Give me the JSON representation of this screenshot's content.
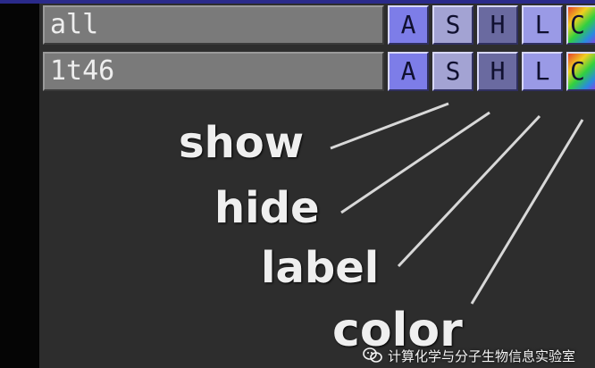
{
  "object_panel": {
    "rows": [
      {
        "name": "all",
        "buttons": {
          "action": "A",
          "show": "S",
          "hide": "H",
          "label": "L",
          "color": "C"
        }
      },
      {
        "name": "1t46",
        "buttons": {
          "action": "A",
          "show": "S",
          "hide": "H",
          "label": "L",
          "color": "C"
        }
      }
    ]
  },
  "annotations": {
    "show": "show",
    "hide": "hide",
    "label": "label",
    "color": "color"
  },
  "watermark": {
    "text": "计算化学与分子生物信息实验室",
    "icon": "wechat-icon"
  },
  "colors": {
    "panel_bg": "#2d2d2d",
    "name_box": "#7a7a7a",
    "action_button": "#7d7de8",
    "show_button": "#a3a3d3",
    "hide_button": "#6a6aa0",
    "label_button": "#9a9ae6"
  }
}
